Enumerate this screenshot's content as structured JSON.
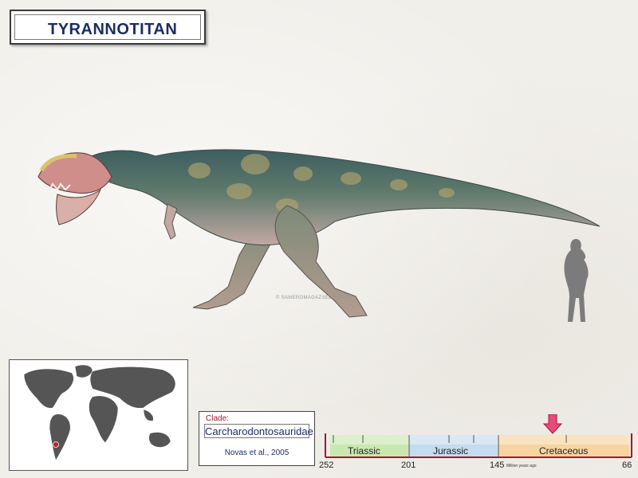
{
  "title": "TYRANNOTITAN",
  "watermark": "© SAMEROMAGAZSEDOMOMA",
  "clade": {
    "label": "Clade:",
    "name": "Carcharodontosauridae",
    "author": "Novas et al., 2005"
  },
  "timeline": {
    "periods": [
      {
        "name": "Triassic",
        "color": "#c8e8b0"
      },
      {
        "name": "Jurassic",
        "color": "#c4dcef"
      },
      {
        "name": "Cretaceous",
        "color": "#f8d4a0"
      }
    ],
    "ticks": [
      "252",
      "201",
      "145",
      "66"
    ],
    "unit": "Million years ago"
  },
  "colors": {
    "title": "#1c2c66",
    "timeline_axis": "#a0192b",
    "marker": "#e84a7a",
    "location_dot": "#c0202a"
  }
}
